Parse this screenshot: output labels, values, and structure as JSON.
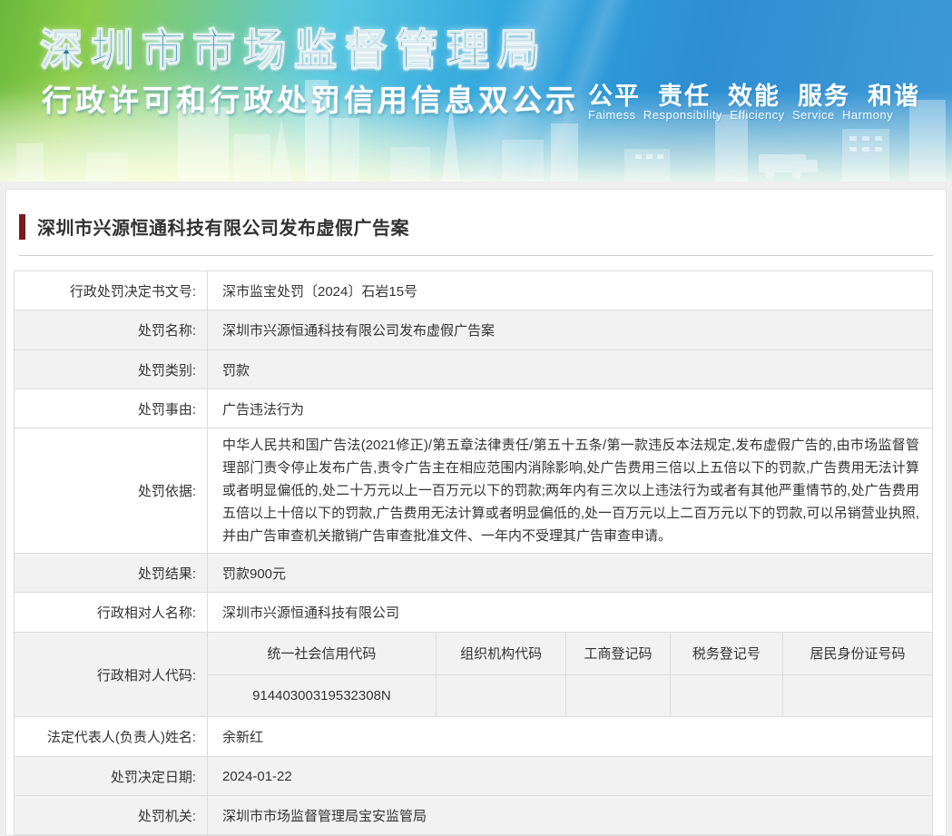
{
  "banner": {
    "title": "深圳市市场监督管理局",
    "subtitle": "行政许可和行政处罚信用信息双公示",
    "slogan_cn": "公平  责任  效能  服务  和谐",
    "slogan_en": "Faimess  Responsibility  Efficiency  Service  Harmony"
  },
  "article": {
    "title": "深圳市兴源恒通科技有限公司发布虚假广告案"
  },
  "record": {
    "rows": [
      {
        "label": "行政处罚决定书文号:",
        "value": "深市监宝处罚〔2024〕石岩15号"
      },
      {
        "label": "处罚名称:",
        "value": "深圳市兴源恒通科技有限公司发布虚假广告案"
      },
      {
        "label": "处罚类别:",
        "value": "罚款"
      },
      {
        "label": "处罚事由:",
        "value": "广告违法行为"
      },
      {
        "label": "处罚依据:",
        "value": "中华人民共和国广告法(2021修正)/第五章法律责任/第五十五条/第一款违反本法规定,发布虚假广告的,由市场监督管理部门责令停止发布广告,责令广告主在相应范围内消除影响,处广告费用三倍以上五倍以下的罚款,广告费用无法计算或者明显偏低的,处二十万元以上一百万元以下的罚款;两年内有三次以上违法行为或者有其他严重情节的,处广告费用五倍以上十倍以下的罚款,广告费用无法计算或者明显偏低的,处一百万元以上二百万元以下的罚款,可以吊销营业执照,并由广告审查机关撤销广告审查批准文件、一年内不受理其广告审查申请。"
      },
      {
        "label": "处罚结果:",
        "value": "罚款900元"
      },
      {
        "label": "行政相对人名称:",
        "value": "深圳市兴源恒通科技有限公司"
      },
      {
        "label": "法定代表人(负责人)姓名:",
        "value": "余新红"
      },
      {
        "label": "处罚决定日期:",
        "value": "2024-01-22"
      },
      {
        "label": "处罚机关:",
        "value": "深圳市市场监督管理局宝安监管局"
      }
    ],
    "party_code": {
      "label": "行政相对人代码:",
      "columns": [
        "统一社会信用代码",
        "组织机构代码",
        "工商登记码",
        "税务登记号",
        "居民身份证号码"
      ],
      "values": [
        "91440300319532308N",
        "",
        "",
        "",
        ""
      ]
    }
  },
  "colors": {
    "title_teal": "#1c7d9a",
    "accent_maroon": "#7a1a1a",
    "row_shade": "#f2f2f2",
    "table_border": "#dcdcdc",
    "page_background": "#efefef"
  }
}
